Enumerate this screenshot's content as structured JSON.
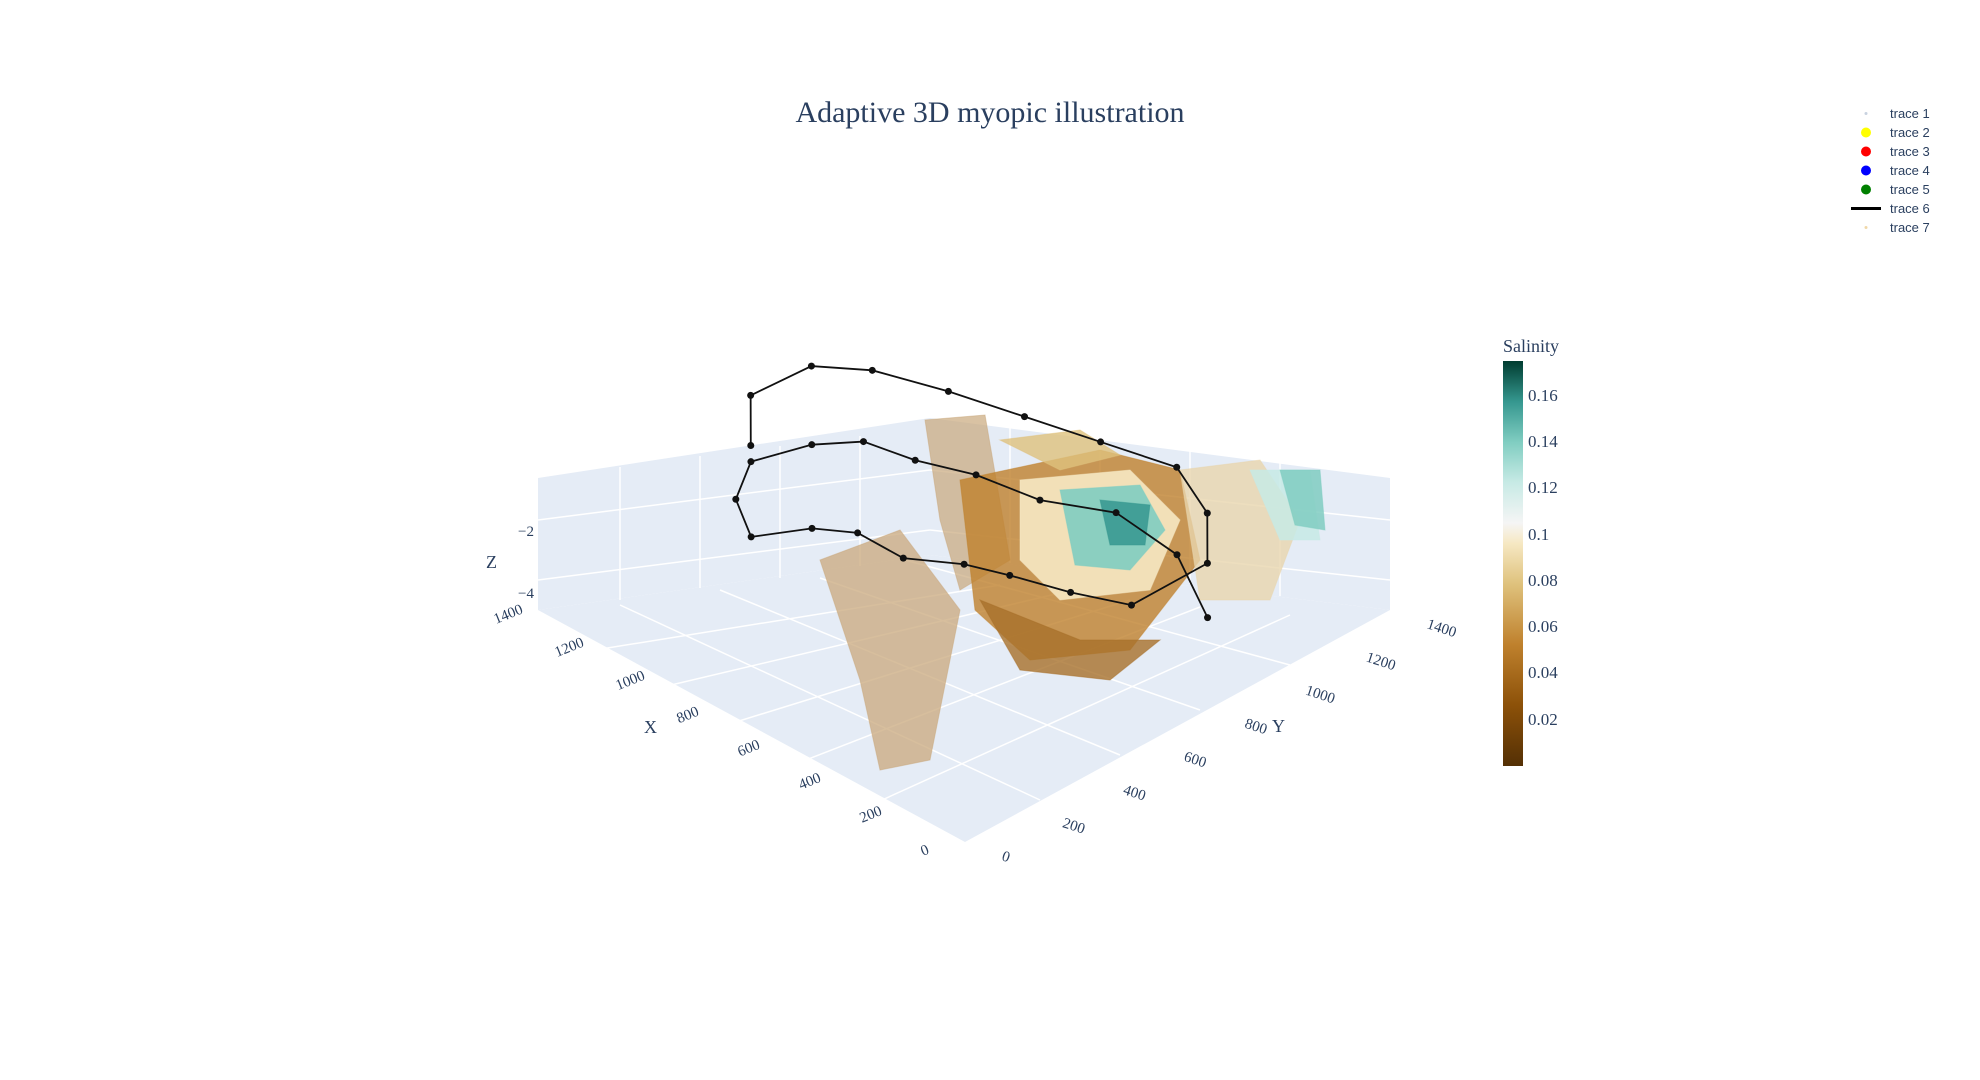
{
  "chart_data": {
    "type": "scatter3d",
    "title": "Adaptive 3D myopic illustration",
    "scene": {
      "xaxis": {
        "title": "X",
        "range": [
          0,
          1400
        ],
        "ticks": [
          "0",
          "200",
          "400",
          "600",
          "800",
          "1000",
          "1200",
          "1400"
        ]
      },
      "yaxis": {
        "title": "Y",
        "range": [
          0,
          1400
        ],
        "ticks": [
          "0",
          "200",
          "400",
          "600",
          "800",
          "1000",
          "1200",
          "1400"
        ]
      },
      "zaxis": {
        "title": "Z",
        "range": [
          -5,
          -1
        ],
        "ticks": [
          "−4",
          "−2"
        ]
      }
    },
    "colorbar": {
      "title": "Salinity",
      "ticks": [
        "0.02",
        "0.04",
        "0.06",
        "0.08",
        "0.1",
        "0.12",
        "0.14",
        "0.16"
      ],
      "tick_values": [
        0.02,
        0.04,
        0.06,
        0.08,
        0.1,
        0.12,
        0.14,
        0.16
      ],
      "range": [
        0.0,
        0.175
      ],
      "colorscale": "BrBG"
    },
    "legend": {
      "placement": "top-right",
      "items": [
        {
          "name": "trace 1",
          "symbol": "dot",
          "color": "#c8d2e0"
        },
        {
          "name": "trace 2",
          "symbol": "marker",
          "color": "#ffff00"
        },
        {
          "name": "trace 3",
          "symbol": "marker",
          "color": "#ff0000"
        },
        {
          "name": "trace 4",
          "symbol": "marker",
          "color": "#0000ff"
        },
        {
          "name": "trace 5",
          "symbol": "marker",
          "color": "#008000"
        },
        {
          "name": "trace 6",
          "symbol": "line",
          "color": "#000000"
        },
        {
          "name": "trace 7",
          "symbol": "dot",
          "color": "#f0d8a8"
        }
      ]
    },
    "path": {
      "name": "trace 6",
      "points": [
        [
          200,
          1000,
          -4.4
        ],
        [
          350,
          1050,
          -3.7
        ],
        [
          500,
          1000,
          -3.1
        ],
        [
          650,
          900,
          -3.0
        ],
        [
          780,
          820,
          -2.6
        ],
        [
          860,
          700,
          -2.1
        ],
        [
          950,
          620,
          -1.7
        ],
        [
          1000,
          500,
          -1.5
        ],
        [
          1100,
          400,
          -1.9
        ],
        [
          1050,
          300,
          -2.2
        ],
        [
          950,
          250,
          -2.5
        ],
        [
          850,
          350,
          -2.3
        ],
        [
          800,
          450,
          -2.6
        ],
        [
          700,
          500,
          -3.0
        ],
        [
          620,
          620,
          -3.3
        ],
        [
          550,
          700,
          -3.6
        ],
        [
          450,
          800,
          -4.0
        ],
        [
          350,
          900,
          -4.3
        ],
        [
          300,
          1100,
          -3.9
        ],
        [
          400,
          1200,
          -3.5
        ],
        [
          550,
          1250,
          -3.2
        ],
        [
          700,
          1150,
          -2.8
        ],
        [
          850,
          1050,
          -2.4
        ],
        [
          1000,
          950,
          -2.0
        ],
        [
          1150,
          850,
          -1.7
        ],
        [
          1250,
          750,
          -1.6
        ],
        [
          1300,
          600,
          -1.9
        ],
        [
          1200,
          500,
          -2.3
        ]
      ]
    },
    "surfaces": [
      {
        "name": "trace 7",
        "salinity_range": [
          0.0,
          0.175
        ]
      }
    ]
  }
}
